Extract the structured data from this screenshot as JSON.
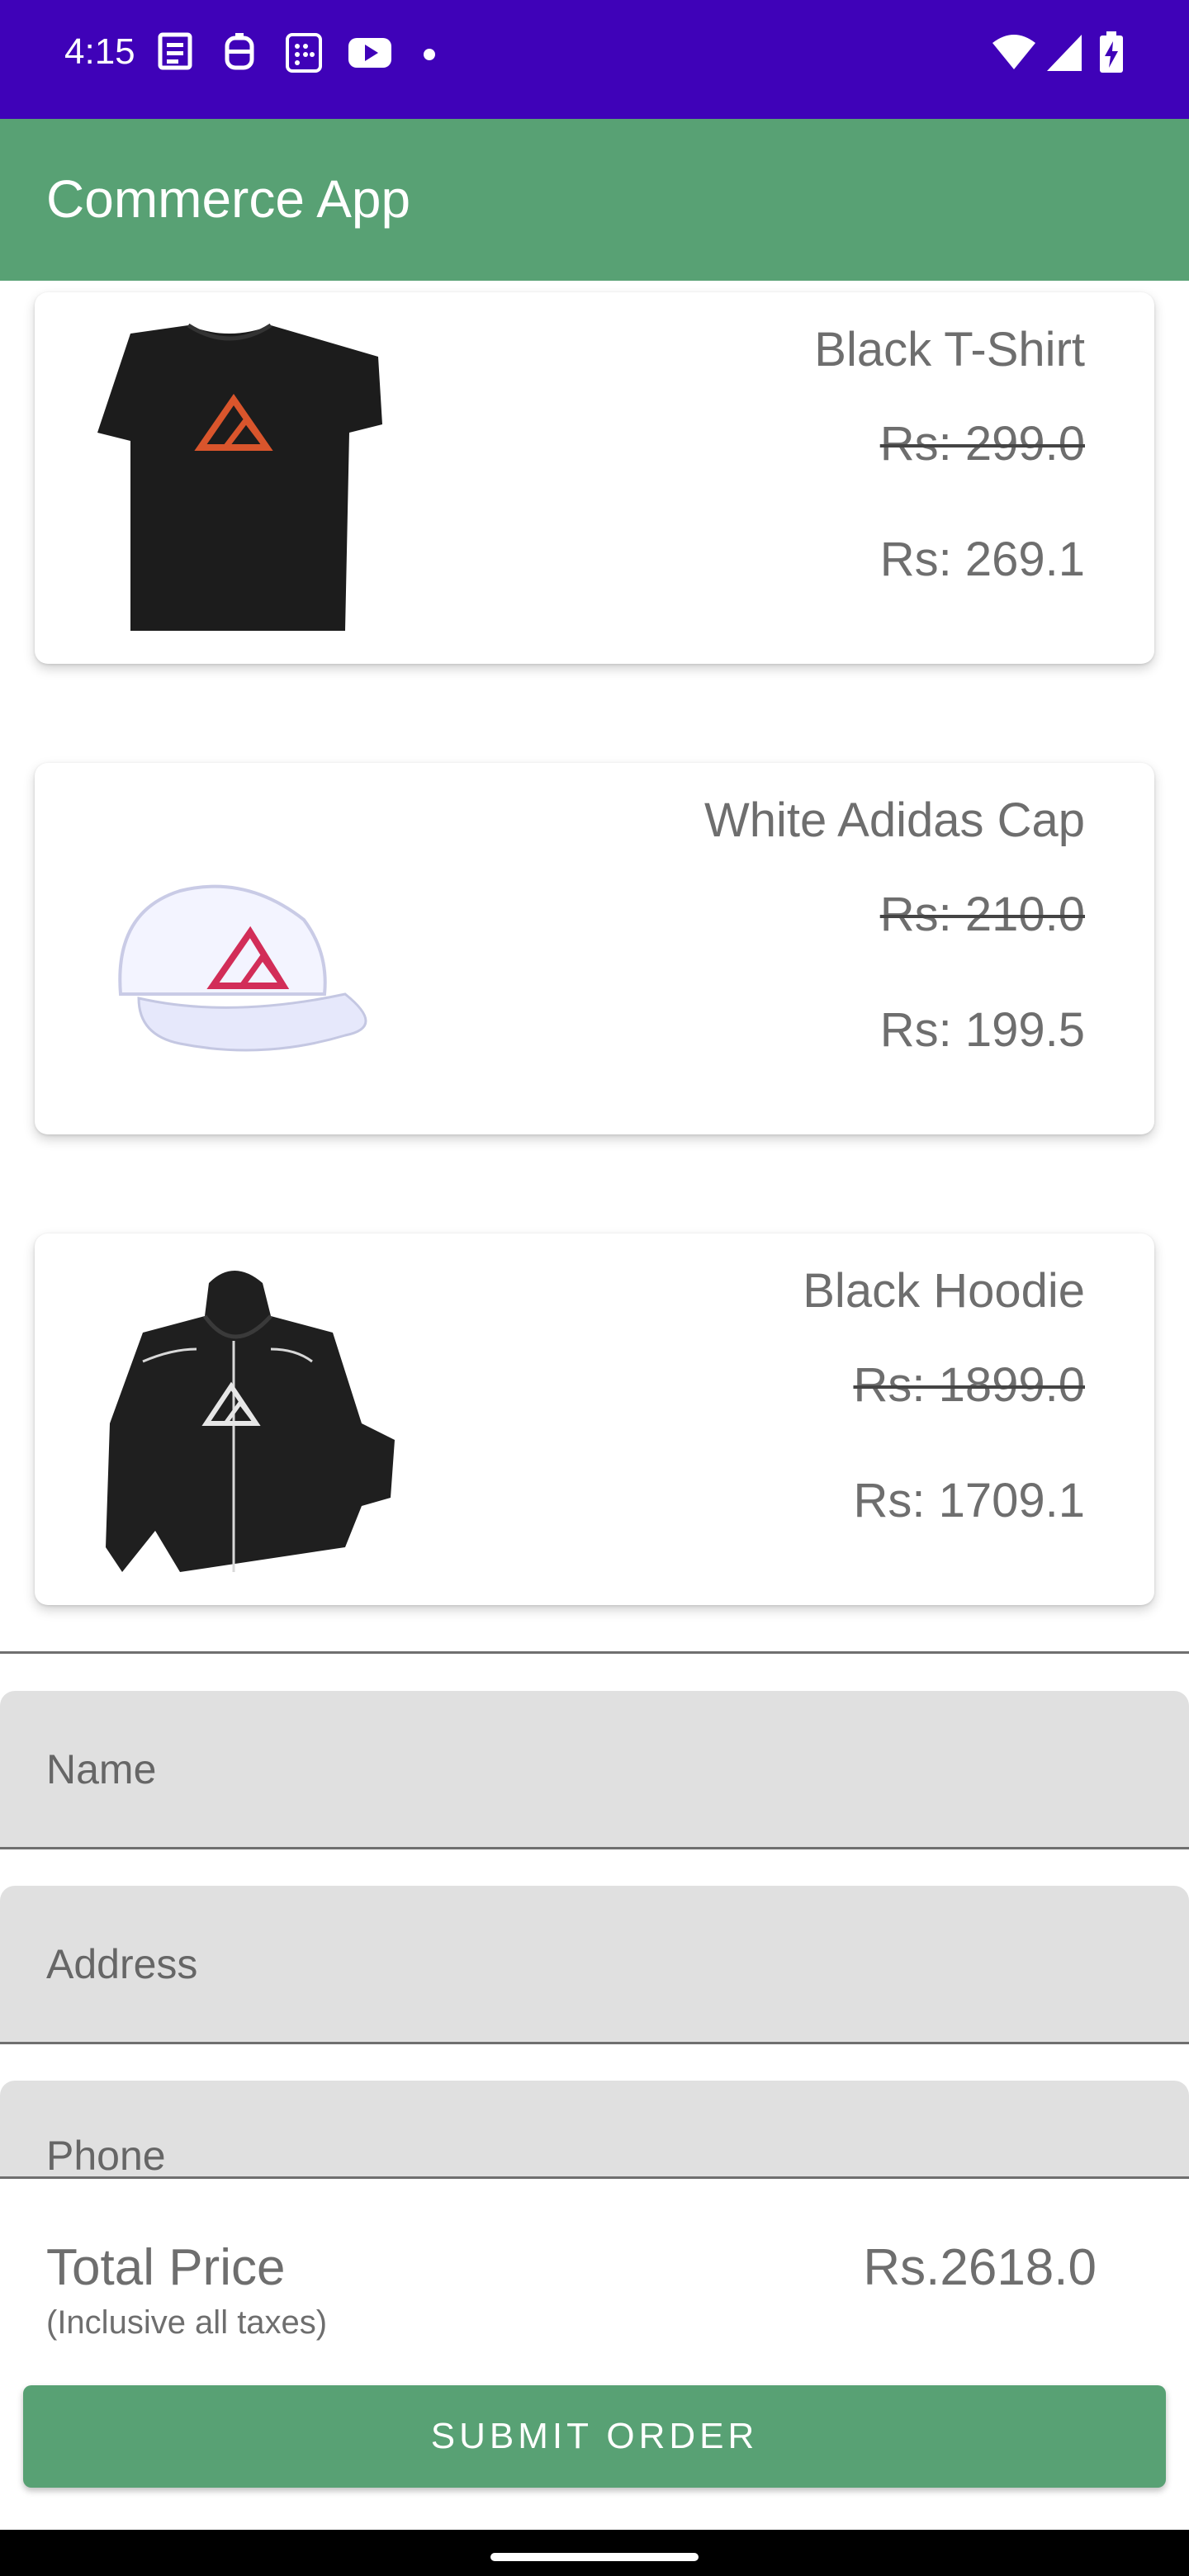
{
  "status_bar": {
    "time": "4:15",
    "left_icons": [
      "news-icon",
      "assistant-icon",
      "sim-icon",
      "youtube-icon",
      "dot-icon"
    ],
    "right_icons": [
      "wifi-icon",
      "signal-icon",
      "battery-charging-icon"
    ],
    "background": "#3f02b8"
  },
  "app_bar": {
    "title": "Commerce App",
    "background": "#58a174"
  },
  "products": [
    {
      "name": "Black T-Shirt",
      "old_price": "Rs: 299.0",
      "new_price": "Rs: 269.1",
      "image": "black-tshirt"
    },
    {
      "name": "White Adidas Cap",
      "old_price": "Rs: 210.0",
      "new_price": "Rs: 199.5",
      "image": "white-cap"
    },
    {
      "name": "Black Hoodie",
      "old_price": "Rs: 1899.0",
      "new_price": "Rs: 1709.1",
      "image": "black-hoodie"
    }
  ],
  "form": {
    "name_placeholder": "Name",
    "address_placeholder": "Address",
    "phone_placeholder": "Phone"
  },
  "summary": {
    "total_label": "Total Price",
    "total_note": "(Inclusive all taxes)",
    "total_value": "Rs.2618.0",
    "submit_label": "SUBMIT ORDER"
  }
}
